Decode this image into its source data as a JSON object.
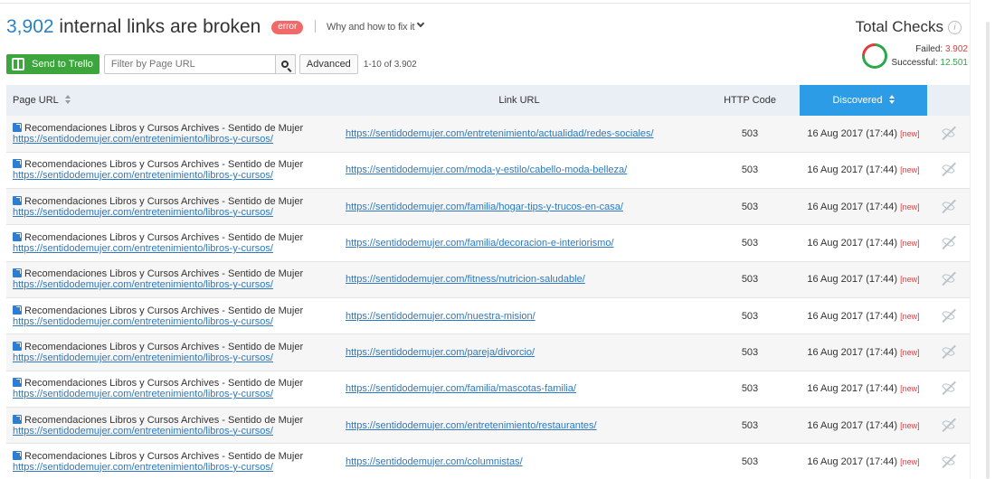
{
  "header": {
    "count": "3,902",
    "title_rest": "internal links are broken",
    "badge": "error",
    "why_link": "Why and how to fix it"
  },
  "toolbar": {
    "trello_label": "Send to Trello",
    "filter_placeholder": "Filter by Page URL",
    "advanced_label": "Advanced",
    "range_text": "1-10 of 3.902"
  },
  "checks": {
    "title": "Total Checks",
    "failed_label": "Failed:",
    "failed_value": "3.902",
    "successful_label": "Successful:",
    "successful_value": "12.501",
    "colors": {
      "failed": "#e53a3a",
      "successful": "#2ea64a"
    }
  },
  "table": {
    "columns": {
      "page_url": "Page URL",
      "link_url": "Link URL",
      "http_code": "HTTP Code",
      "discovered": "Discovered"
    },
    "rows": [
      {
        "page_title": "Recomendaciones Libros y Cursos Archives - Sentido de Mujer",
        "page_url": "https://sentidodemujer.com/entretenimiento/libros-y-cursos/",
        "link_url": "https://sentidodemujer.com/entretenimiento/actualidad/redes-sociales/",
        "code": "503",
        "date": "16 Aug 2017 (17:44)",
        "tag": "[new]"
      },
      {
        "page_title": "Recomendaciones Libros y Cursos Archives - Sentido de Mujer",
        "page_url": "https://sentidodemujer.com/entretenimiento/libros-y-cursos/",
        "link_url": "https://sentidodemujer.com/moda-y-estilo/cabello-moda-belleza/",
        "code": "503",
        "date": "16 Aug 2017 (17:44)",
        "tag": "[new]"
      },
      {
        "page_title": "Recomendaciones Libros y Cursos Archives - Sentido de Mujer",
        "page_url": "https://sentidodemujer.com/entretenimiento/libros-y-cursos/",
        "link_url": "https://sentidodemujer.com/familia/hogar-tips-y-trucos-en-casa/",
        "code": "503",
        "date": "16 Aug 2017 (17:44)",
        "tag": "[new]"
      },
      {
        "page_title": "Recomendaciones Libros y Cursos Archives - Sentido de Mujer",
        "page_url": "https://sentidodemujer.com/entretenimiento/libros-y-cursos/",
        "link_url": "https://sentidodemujer.com/familia/decoracion-e-interiorismo/",
        "code": "503",
        "date": "16 Aug 2017 (17:44)",
        "tag": "[new]"
      },
      {
        "page_title": "Recomendaciones Libros y Cursos Archives - Sentido de Mujer",
        "page_url": "https://sentidodemujer.com/entretenimiento/libros-y-cursos/",
        "link_url": "https://sentidodemujer.com/fitness/nutricion-saludable/",
        "code": "503",
        "date": "16 Aug 2017 (17:44)",
        "tag": "[new]"
      },
      {
        "page_title": "Recomendaciones Libros y Cursos Archives - Sentido de Mujer",
        "page_url": "https://sentidodemujer.com/entretenimiento/libros-y-cursos/",
        "link_url": "https://sentidodemujer.com/nuestra-mision/",
        "code": "503",
        "date": "16 Aug 2017 (17:44)",
        "tag": "[new]"
      },
      {
        "page_title": "Recomendaciones Libros y Cursos Archives - Sentido de Mujer",
        "page_url": "https://sentidodemujer.com/entretenimiento/libros-y-cursos/",
        "link_url": "https://sentidodemujer.com/pareja/divorcio/",
        "code": "503",
        "date": "16 Aug 2017 (17:44)",
        "tag": "[new]"
      },
      {
        "page_title": "Recomendaciones Libros y Cursos Archives - Sentido de Mujer",
        "page_url": "https://sentidodemujer.com/entretenimiento/libros-y-cursos/",
        "link_url": "https://sentidodemujer.com/familia/mascotas-familia/",
        "code": "503",
        "date": "16 Aug 2017 (17:44)",
        "tag": "[new]"
      },
      {
        "page_title": "Recomendaciones Libros y Cursos Archives - Sentido de Mujer",
        "page_url": "https://sentidodemujer.com/entretenimiento/libros-y-cursos/",
        "link_url": "https://sentidodemujer.com/entretenimiento/restaurantes/",
        "code": "503",
        "date": "16 Aug 2017 (17:44)",
        "tag": "[new]"
      },
      {
        "page_title": "Recomendaciones Libros y Cursos Archives - Sentido de Mujer",
        "page_url": "https://sentidodemujer.com/entretenimiento/libros-y-cursos/",
        "link_url": "https://sentidodemujer.com/columnistas/",
        "code": "503",
        "date": "16 Aug 2017 (17:44)",
        "tag": "[new]"
      }
    ]
  }
}
